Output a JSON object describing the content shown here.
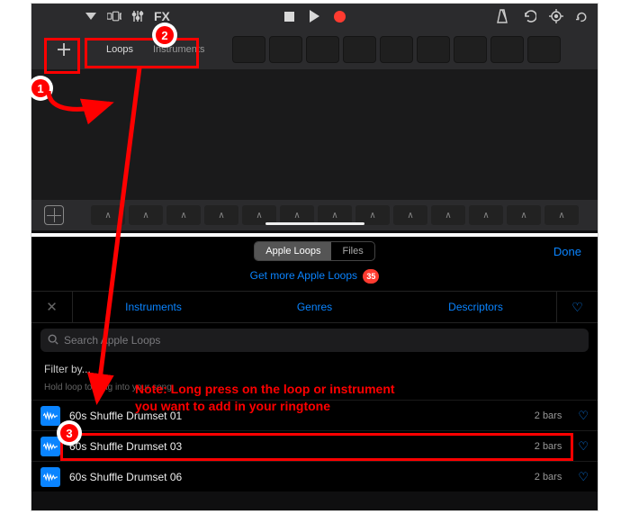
{
  "toolbar": {
    "fx_label": "FX"
  },
  "tracks": {
    "tabs": {
      "loops": "Loops",
      "instruments": "Instruments"
    }
  },
  "browser": {
    "tabs": {
      "apple_loops": "Apple Loops",
      "files": "Files"
    },
    "done_label": "Done",
    "get_more_label": "Get more Apple Loops",
    "get_more_badge": "35",
    "filters": {
      "instruments": "Instruments",
      "genres": "Genres",
      "descriptors": "Descriptors"
    },
    "search_placeholder": "Search Apple Loops",
    "filter_by_label": "Filter by...",
    "drag_hint": "Hold loop to drag into your song.",
    "loops": [
      {
        "name": "60s Shuffle Drumset 01",
        "bars": "2 bars"
      },
      {
        "name": "60s Shuffle Drumset 03",
        "bars": "2 bars"
      },
      {
        "name": "60s Shuffle Drumset 06",
        "bars": "2 bars"
      }
    ]
  },
  "annotations": {
    "c1": "1",
    "c2": "2",
    "c3": "3",
    "note_line1": "Note: Long press on the loop or instrument",
    "note_line2": "you want to add in your ringtone"
  }
}
